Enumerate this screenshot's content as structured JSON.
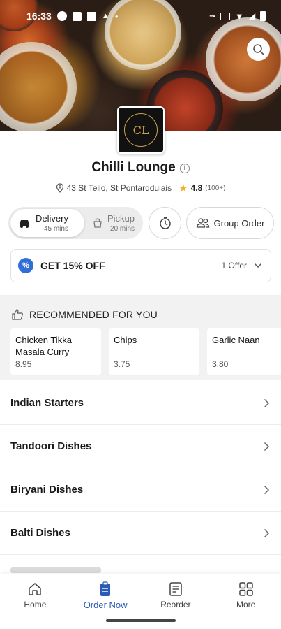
{
  "status_bar": {
    "time": "16:33"
  },
  "restaurant": {
    "name": "Chilli Lounge",
    "address": "43 St Teilo, St Pontarddulais",
    "rating": "4.8",
    "rating_count": "(100+)",
    "logo_initials": "CL"
  },
  "order_mode": {
    "delivery": {
      "label": "Delivery",
      "time": "45 mins"
    },
    "pickup": {
      "label": "Pickup",
      "time": "20 mins"
    },
    "group_order_label": "Group Order"
  },
  "offer": {
    "badge": "%",
    "title": "GET 15% OFF",
    "count": "1 Offer"
  },
  "recommended": {
    "heading": "RECOMMENDED FOR YOU",
    "items": [
      {
        "name": "Chicken Tikka Masala Curry",
        "price": "8.95"
      },
      {
        "name": "Chips",
        "price": "3.75"
      },
      {
        "name": "Garlic Naan",
        "price": "3.80"
      }
    ]
  },
  "categories": [
    {
      "label": "Indian Starters"
    },
    {
      "label": "Tandoori Dishes"
    },
    {
      "label": "Biryani Dishes"
    },
    {
      "label": "Balti Dishes"
    }
  ],
  "bottom_nav": [
    {
      "label": "Home",
      "icon": "home-icon"
    },
    {
      "label": "Order Now",
      "icon": "order-icon"
    },
    {
      "label": "Reorder",
      "icon": "receipt-icon"
    },
    {
      "label": "More",
      "icon": "grid-icon"
    }
  ],
  "colors": {
    "accent": "#2a5bb8",
    "offer_badge": "#2f6fd6",
    "star": "#f2b01e"
  }
}
